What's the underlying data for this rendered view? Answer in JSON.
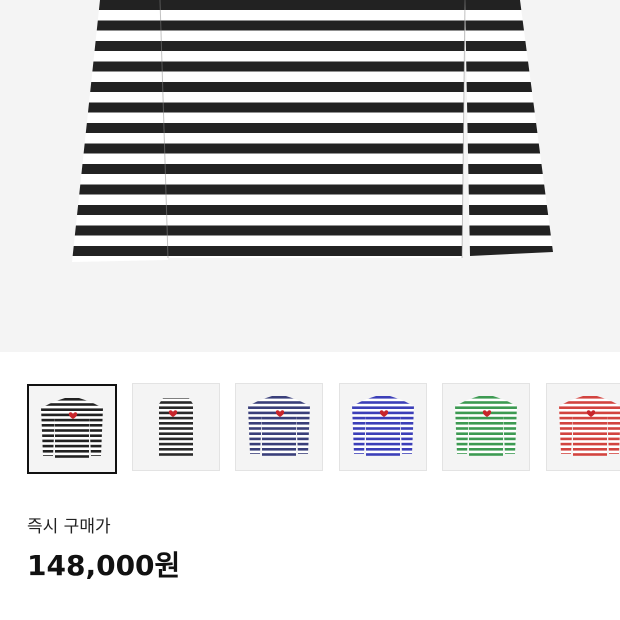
{
  "product": {
    "buy_now_label": "즉시 구매가",
    "price": "148,000원"
  },
  "colors": {
    "hero_bg": "#f4f4f4",
    "stripe_dark": "#222222"
  },
  "thumbnails": [
    {
      "variant": "black-white-stripe-front",
      "stripe": "#222222",
      "selected": true
    },
    {
      "variant": "black-white-stripe-side",
      "stripe": "#2a2a2a",
      "selected": false
    },
    {
      "variant": "navy-white-stripe",
      "stripe": "#3a3f7a",
      "selected": false
    },
    {
      "variant": "blue-white-stripe",
      "stripe": "#3c3fb8",
      "selected": false
    },
    {
      "variant": "green-white-stripe",
      "stripe": "#3d9a52",
      "selected": false
    },
    {
      "variant": "red-white-stripe",
      "stripe": "#d2443f",
      "selected": false
    }
  ]
}
